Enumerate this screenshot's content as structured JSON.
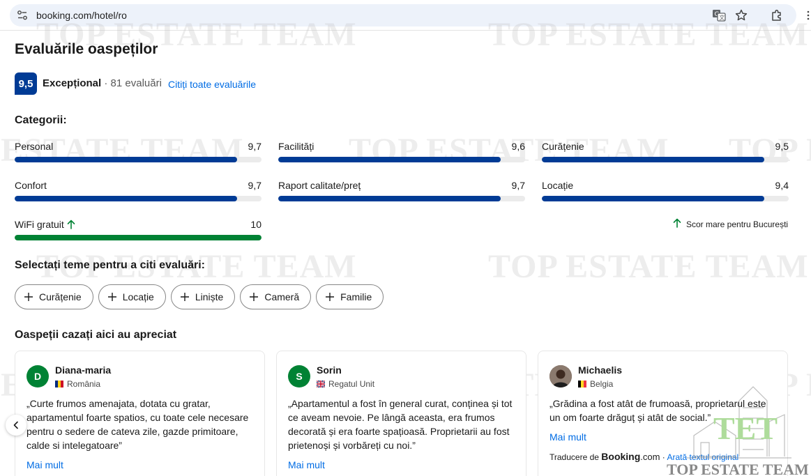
{
  "browser": {
    "url": "booking.com/hotel/ro"
  },
  "watermark": {
    "text": "TOP ESTATE TEAM"
  },
  "reviews": {
    "title": "Evaluările oaspeților",
    "score": "9,5",
    "score_word": "Excepțional",
    "separator": "·",
    "count": "81 evaluări",
    "read_all": "Citiți toate evaluările"
  },
  "categories": {
    "heading": "Categorii:",
    "items": [
      {
        "label": "Personal",
        "value": "9,7",
        "fraction": 0.9
      },
      {
        "label": "Facilități",
        "value": "9,6",
        "fraction": 0.9
      },
      {
        "label": "Curățenie",
        "value": "9,5",
        "fraction": 0.9
      },
      {
        "label": "Confort",
        "value": "9,7",
        "fraction": 0.9
      },
      {
        "label": "Raport calitate/preț",
        "value": "9,7",
        "fraction": 0.9
      },
      {
        "label": "Locație",
        "value": "9,4",
        "fraction": 0.9
      },
      {
        "label": "WiFi gratuit",
        "value": "10",
        "fraction": 1.0
      }
    ],
    "high_score_note": "Scor mare pentru București",
    "colors": {
      "bar": "#003b95",
      "bar_high": "#008234"
    }
  },
  "topics": {
    "heading": "Selectați teme pentru a citi evaluări:",
    "chips": [
      "Curățenie",
      "Locație",
      "Liniște",
      "Cameră",
      "Familie"
    ]
  },
  "liked": {
    "heading": "Oaspeții cazați aici au apreciat",
    "cards": [
      {
        "avatar_letter": "D",
        "name": "Diana-maria",
        "country": "România",
        "text": "„Curte frumos amenajata, dotata cu gratar, apartamentul foarte spatios, cu toate cele necesare pentru o sedere de cateva zile, gazde primitoare, calde si intelegatoare”",
        "more": "Mai mult"
      },
      {
        "avatar_letter": "S",
        "name": "Sorin",
        "country": "Regatul Unit",
        "text": "„Apartamentul a fost în general curat, conținea și tot ce aveam nevoie. Pe lângă aceasta, era frumos decorată și era foarte spațioasă. Proprietarii au fost prietenoși și vorbăreți cu noi.”",
        "more": "Mai mult"
      },
      {
        "name": "Michaelis",
        "country": "Belgia",
        "text": "„Grădina a fost atât de frumoasă, proprietarul este un om foarte drăguț și atât de social.”",
        "more": "Mai mult",
        "translated_by": "Traducere de",
        "booking_brand": "Booking",
        "booking_tld": ".com",
        "orig_separator": "·",
        "show_original": "Arată textul original"
      }
    ]
  },
  "logo_watermark": {
    "mark": "TET",
    "text": "TOP ESTATE TEAM"
  }
}
